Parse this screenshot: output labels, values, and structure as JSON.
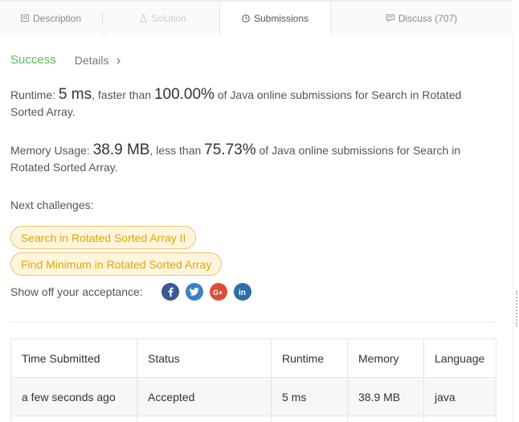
{
  "tabs": [
    {
      "label": "Description",
      "icon": "document-icon"
    },
    {
      "label": "Solution",
      "icon": "flask-icon"
    },
    {
      "label": "Submissions",
      "icon": "clock-icon"
    },
    {
      "label": "Discuss (707)",
      "icon": "comment-icon"
    }
  ],
  "result": {
    "status": "Success",
    "details_label": "Details",
    "runtime_prefix": "Runtime: ",
    "runtime_value": "5 ms",
    "runtime_mid": ", faster than ",
    "runtime_pct": "100.00%",
    "runtime_suffix": " of Java online submissions for Search in Rotated Sorted Array.",
    "memory_prefix": "Memory Usage: ",
    "memory_value": "38.9 MB",
    "memory_mid": ", less than ",
    "memory_pct": "75.73%",
    "memory_suffix": " of Java online submissions for Search in Rotated Sorted Array."
  },
  "next": {
    "label": "Next challenges:",
    "items": [
      "Search in Rotated Sorted Array II",
      "Find Minimum in Rotated Sorted Array"
    ]
  },
  "share": {
    "label": "Show off your acceptance:",
    "networks": [
      "facebook",
      "twitter",
      "google-plus",
      "linkedin"
    ]
  },
  "table": {
    "headers": [
      "Time Submitted",
      "Status",
      "Runtime",
      "Memory",
      "Language"
    ],
    "rows": [
      [
        "a few seconds ago",
        "Accepted",
        "5 ms",
        "38.9 MB",
        "java"
      ]
    ]
  },
  "colors": {
    "success": "#5cb85c",
    "chip_text": "#e0a800",
    "chip_bg": "#fff5dd"
  }
}
